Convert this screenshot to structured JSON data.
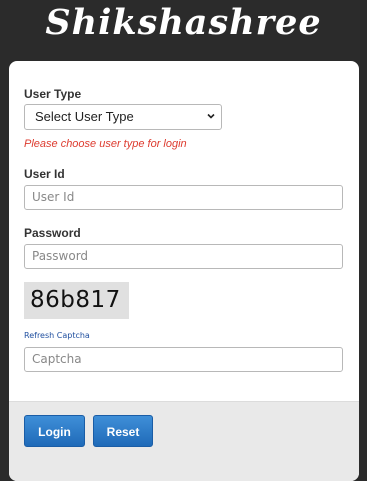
{
  "app": {
    "title": "Shikshashree"
  },
  "form": {
    "user_type": {
      "label": "User Type",
      "selected": "Select User Type",
      "error": "Please choose user type for login"
    },
    "user_id": {
      "label": "User Id",
      "placeholder": "User Id"
    },
    "password": {
      "label": "Password",
      "placeholder": "Password"
    },
    "captcha": {
      "code": "86b817",
      "refresh_label": "Refresh Captcha",
      "placeholder": "Captcha"
    }
  },
  "actions": {
    "login_label": "Login",
    "reset_label": "Reset"
  },
  "colors": {
    "background": "#2b2b2b",
    "card": "#ffffff",
    "footer": "#e9e9e9",
    "button": "#2a76c6",
    "error": "#dd3b2f",
    "link": "#1f4f9f",
    "captcha_bg": "#e0e0e0"
  },
  "icons": {
    "select": "chevron-down-icon"
  }
}
